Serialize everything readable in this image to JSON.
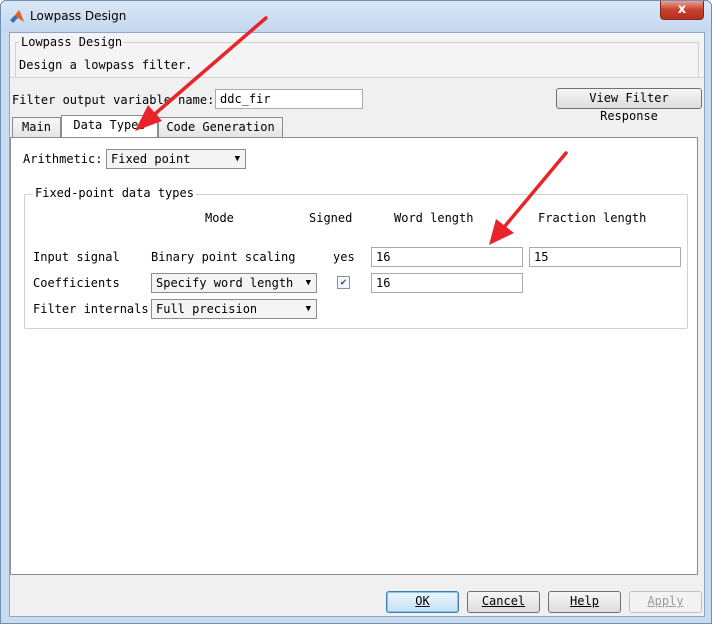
{
  "window": {
    "title": "Lowpass Design",
    "close_glyph": "x"
  },
  "header": {
    "title": "Lowpass Design",
    "description": "Design a lowpass filter."
  },
  "filter_var": {
    "label": "Filter output variable name:",
    "value": "ddc_fir"
  },
  "view_response_button": "View Filter Response",
  "tabs": [
    {
      "label": "Main"
    },
    {
      "label": "Data Types"
    },
    {
      "label": "Code Generation"
    }
  ],
  "arithmetic": {
    "label": "Arithmetic:",
    "selected": "Fixed point"
  },
  "fixed_point": {
    "title": "Fixed-point data types",
    "headers": {
      "mode": "Mode",
      "signed": "Signed",
      "word_length": "Word length",
      "fraction_length": "Fraction length"
    },
    "rows": {
      "input_signal": {
        "label": "Input signal",
        "mode": "Binary point scaling",
        "signed": "yes",
        "word_length": "16",
        "fraction_length": "15"
      },
      "coefficients": {
        "label": "Coefficients",
        "mode": "Specify word length",
        "signed_checked": true,
        "word_length": "16"
      },
      "filter_internals": {
        "label": "Filter internals",
        "mode": "Full precision"
      }
    }
  },
  "footer": {
    "ok": "OK",
    "cancel": "Cancel",
    "help": "Help",
    "apply": "Apply"
  },
  "annotation_color": "#e8232a"
}
